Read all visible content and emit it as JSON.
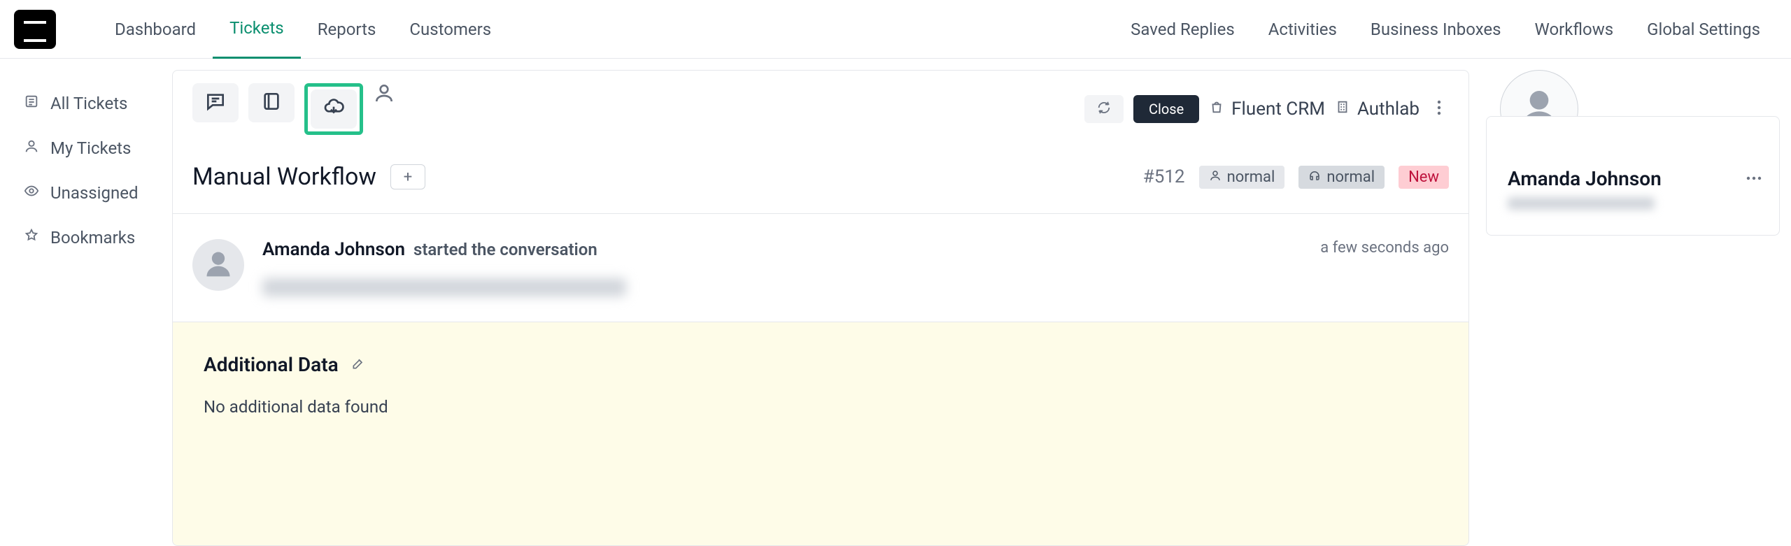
{
  "topnav": {
    "left": [
      {
        "label": "Dashboard"
      },
      {
        "label": "Tickets"
      },
      {
        "label": "Reports"
      },
      {
        "label": "Customers"
      }
    ],
    "active_index": 1,
    "right": [
      {
        "label": "Saved Replies"
      },
      {
        "label": "Activities"
      },
      {
        "label": "Business Inboxes"
      },
      {
        "label": "Workflows"
      },
      {
        "label": "Global Settings"
      }
    ]
  },
  "sidebar": {
    "items": [
      {
        "label": "All Tickets",
        "icon": "list-icon"
      },
      {
        "label": "My Tickets",
        "icon": "user-icon"
      },
      {
        "label": "Unassigned",
        "icon": "eye-icon"
      },
      {
        "label": "Bookmarks",
        "icon": "bookmark-icon"
      }
    ]
  },
  "toolbar": {
    "close_label": "Close",
    "crm_label": "Fluent CRM",
    "authlab_label": "Authlab"
  },
  "ticket": {
    "title": "Manual Workflow",
    "id": "#512",
    "pills": {
      "priority1": "normal",
      "priority2": "normal",
      "status": "New"
    }
  },
  "conversation": {
    "author": "Amanda Johnson",
    "verb": "started the conversation",
    "timestamp": "a few seconds ago"
  },
  "additional": {
    "title": "Additional Data",
    "body": "No additional data found"
  },
  "customer": {
    "name": "Amanda Johnson"
  }
}
